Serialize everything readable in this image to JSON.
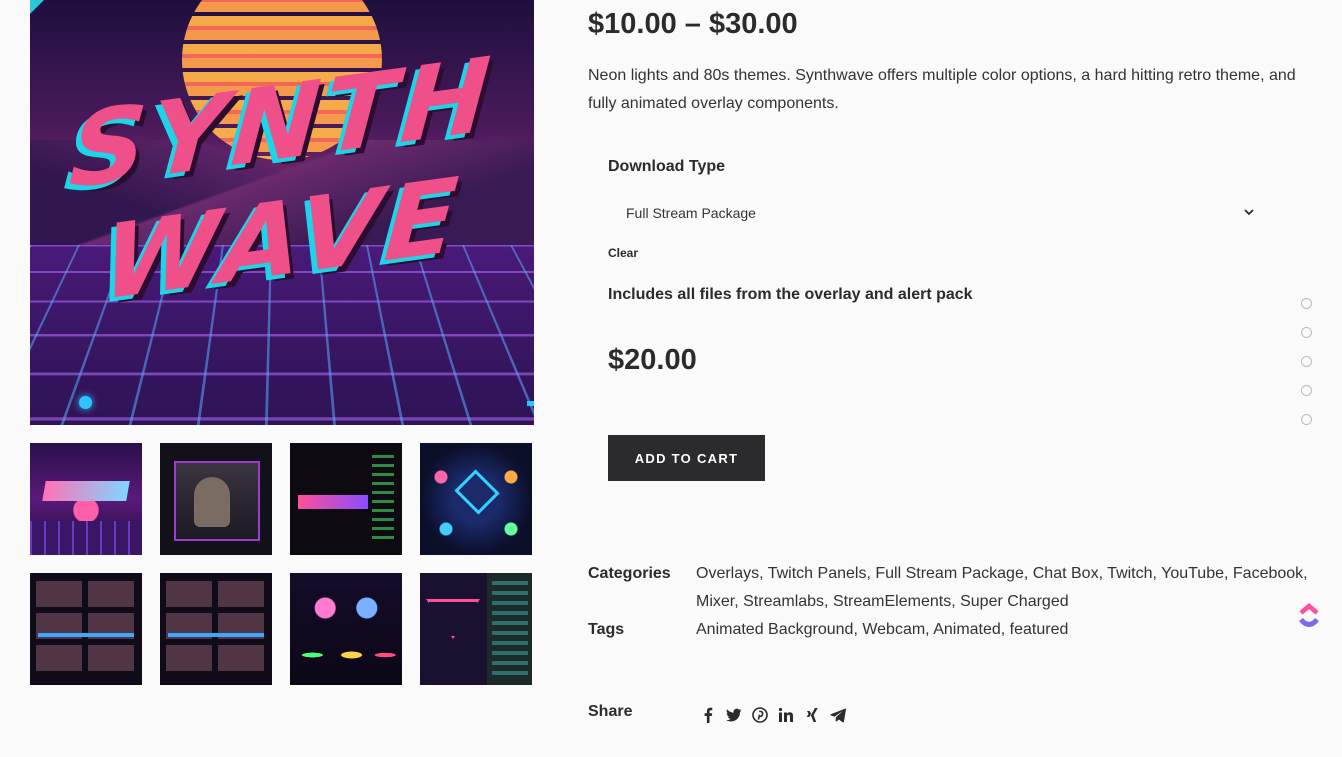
{
  "product": {
    "price_range": "$10.00 – $30.00",
    "description": "Neon lights and 80s themes. Synthwave offers multiple color options, a hard hitting retro theme, and fully animated overlay components.",
    "hero_title_line1": "SYNTH",
    "hero_title_line2": "WAVE"
  },
  "variation": {
    "label": "Download Type",
    "selected": "Full Stream Package",
    "clear_label": "Clear",
    "includes_text": "Includes all files from the overlay and alert pack",
    "price": "$20.00"
  },
  "cart": {
    "add_label": "ADD TO CART"
  },
  "meta": {
    "categories_label": "Categories",
    "categories": [
      "Overlays",
      "Twitch Panels",
      "Full Stream Package",
      "Chat Box",
      "Twitch",
      "YouTube",
      "Facebook",
      "Mixer",
      "Streamlabs",
      "StreamElements",
      "Super Charged"
    ],
    "tags_label": "Tags",
    "tags": [
      "Animated Background",
      "Webcam",
      "Animated",
      "featured"
    ]
  },
  "share": {
    "label": "Share",
    "icons": [
      "facebook-icon",
      "twitter-icon",
      "pinterest-icon",
      "linkedin-icon",
      "xing-icon",
      "telegram-icon"
    ]
  },
  "gallery": {
    "thumbnail_count": 8
  },
  "side_dots": {
    "count": 5
  },
  "colors": {
    "button_bg": "#2b2b2e",
    "text": "#2b2b2b",
    "page_bg": "#fafafa",
    "accent_pink": "#f0508a",
    "accent_cyan": "#1bd6e8"
  }
}
